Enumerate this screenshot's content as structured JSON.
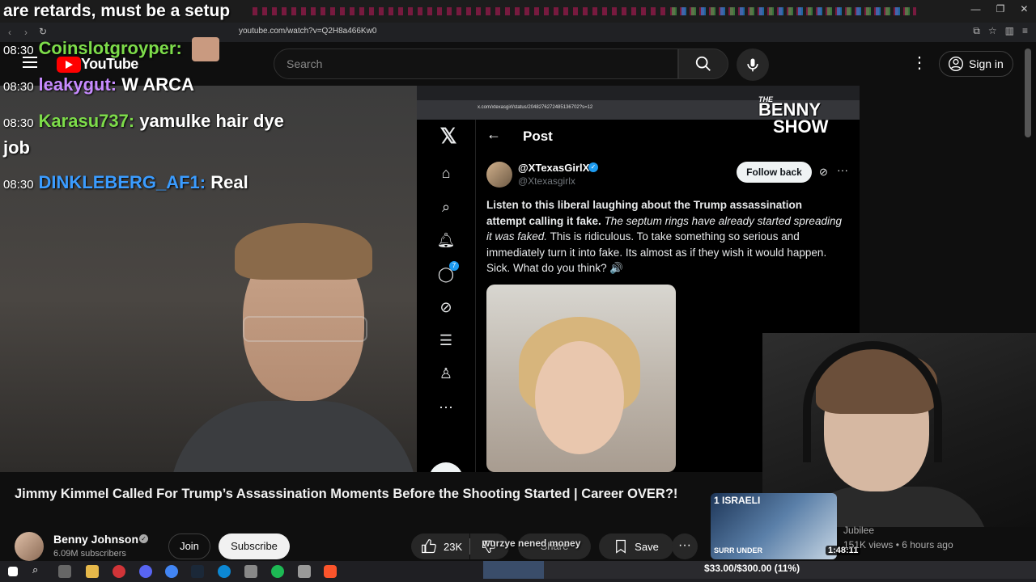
{
  "overlay": {
    "top_text": "are retards, must be a setup",
    "goal_text": "$33.00/$300.00 (11%)",
    "goal_fraction": 0.11,
    "money_text": "wurzye nened money"
  },
  "chat": [
    {
      "time": "08:30",
      "user": "Coinslotgroyper:",
      "message": "",
      "color": "#7ddc4a"
    },
    {
      "time": "08:30",
      "user": "leakygut:",
      "message": "W ARCA",
      "color": "#c78bff"
    },
    {
      "time": "08:30",
      "user": "Karasu737:",
      "message": "yamulke hair dye",
      "color": "#7ddc4a"
    },
    {
      "time": "",
      "user": "",
      "message": "job",
      "color": "#ffffff"
    },
    {
      "time": "08:30",
      "user": "DINKLEBERG_AF1:",
      "message": "Real",
      "color": "#3b9cff"
    }
  ],
  "browser": {
    "url": "youtube.com/watch?v=Q2H8a466Kw0"
  },
  "youtube": {
    "logo_text": "YouTube",
    "search_placeholder": "Search",
    "signin_label": "Sign in",
    "video_title": "Jimmy Kimmel Called For Trump’s Assassination Moments Before the Shooting Started | Career OVER?!",
    "channel_name": "Benny Johnson",
    "subscribers": "6.09M subscribers",
    "join_label": "Join",
    "subscribe_label": "Subscribe",
    "likes": "23K",
    "share_label": "Share",
    "save_label": "Save",
    "recommended": {
      "thumb_text": "1 ISRAELI",
      "thumb_text2": "SURR UNDER",
      "duration": "1:48:11",
      "channel": "Jubilee",
      "meta": "151K views • 6 hours ago"
    }
  },
  "benny_logo": {
    "the": "THE",
    "name": "BENNY",
    "show": "SHOW"
  },
  "xpost": {
    "url": "x.com/xtexasgirl/status/2048276272485136702?s=12",
    "title": "Post",
    "display_name": "@XTexasGirlX",
    "handle": "@Xtexasgirlx",
    "follow_label": "Follow back",
    "text_bold": "Listen to this liberal laughing about the Trump assassination attempt calling it fake.",
    "text_italic": "The septum rings have already started spreading it was faked.",
    "text_rest": "This is ridiculous. To take something so serious and immediately turn it into fake. Its almost as if they wish it would happen. Sick. What do you think? 🔊",
    "notification_count": "7"
  }
}
